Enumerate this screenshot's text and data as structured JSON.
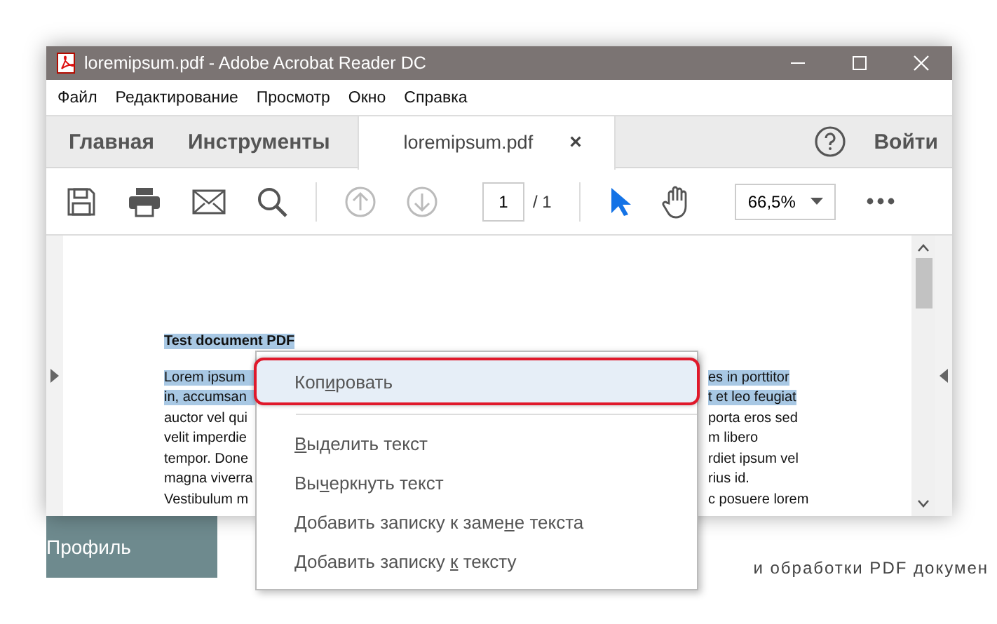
{
  "window": {
    "title": "loremipsum.pdf - Adobe Acrobat Reader DC"
  },
  "menu_bar": [
    "Файл",
    "Редактирование",
    "Просмотр",
    "Окно",
    "Справка"
  ],
  "tabs": [
    {
      "label": "Главная",
      "selected": false
    },
    {
      "label": "Инструменты",
      "selected": false
    },
    {
      "label": "loremipsum.pdf",
      "selected": true,
      "close": "×"
    }
  ],
  "sign_in": "Войти",
  "toolbar": {
    "page_nav_disabled": true,
    "page": "1",
    "page_total": "/ 1",
    "zoom": "66,5%",
    "tools": [
      {
        "kind": "select",
        "selected": true
      },
      {
        "kind": "hand",
        "selected": false
      }
    ]
  },
  "document": {
    "heading": "Test document PDF",
    "heading_highlighted": true,
    "lines": [
      {
        "left": "Lorem ipsum",
        "right": "es in porttitor",
        "highlighted": true
      },
      {
        "left": "in, accumsan",
        "right": "t et leo feugiat",
        "highlighted": true
      },
      {
        "left": "auctor vel qui",
        "right": "porta eros sed",
        "highlighted": false
      },
      {
        "left": "velit imperdie",
        "right": "m libero",
        "highlighted": false
      },
      {
        "left": "tempor. Done",
        "right": "rdiet ipsum vel",
        "highlighted": false
      },
      {
        "left": "magna viverra",
        "right": "rius id.",
        "highlighted": false
      },
      {
        "left": "Vestibulum m",
        "right": "c posuere lorem",
        "highlighted": false
      }
    ]
  },
  "context_menu": {
    "items": [
      {
        "before": "Коп",
        "key": "и",
        "after": "ровать",
        "selected": true,
        "separator_after": true
      },
      {
        "key": "В",
        "after": "ыделить текст",
        "selected": false,
        "separator_after": false
      },
      {
        "before": "Вы",
        "key": "ч",
        "after": "еркнуть текст",
        "selected": false,
        "separator_after": false
      },
      {
        "before": "Добавить записку к заме",
        "key": "н",
        "after": "е текста",
        "selected": false,
        "separator_after": false
      },
      {
        "before": "Добавить записку ",
        "key": "к",
        "after": " тексту",
        "selected": false,
        "separator_after": false
      }
    ]
  },
  "background_page": {
    "sidebar_item": "Профиль",
    "text": "и обработки PDF докумен"
  }
}
